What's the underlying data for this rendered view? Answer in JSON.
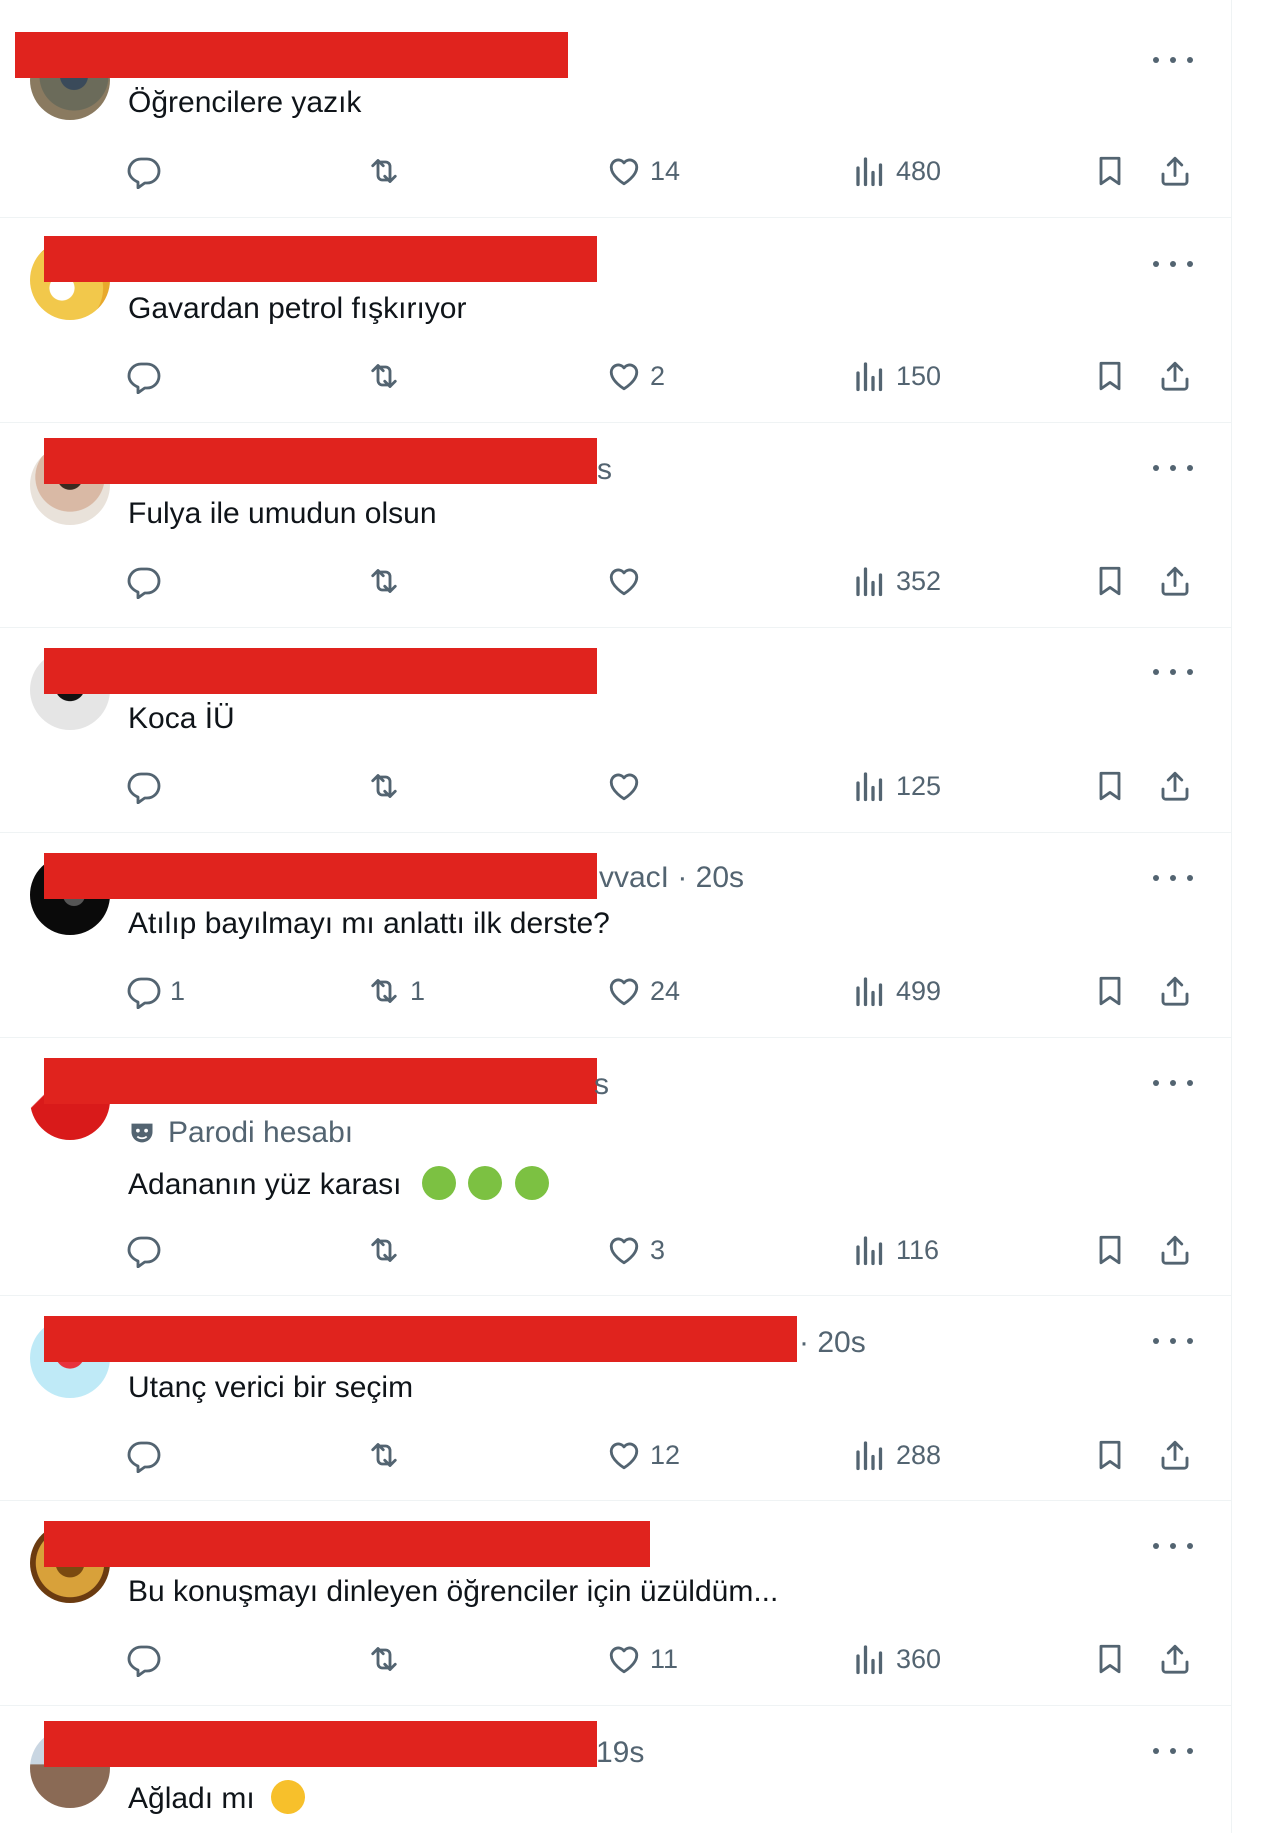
{
  "colors": {
    "redaction": "#e0231e",
    "secondary_text": "#536471",
    "divider": "#eff3f4"
  },
  "icons": {
    "reply": "reply-icon",
    "retweet": "retweet-icon",
    "like": "heart-icon",
    "views": "views-icon",
    "bookmark": "bookmark-icon",
    "share": "share-icon",
    "more": "more-icon"
  },
  "tweets": [
    {
      "header_tail": "",
      "text": "Öğrencilere yazık",
      "replies": "",
      "retweets": "",
      "likes": "14",
      "views": "480"
    },
    {
      "header_tail": "",
      "text": "Gavardan petrol fışkırıyor",
      "replies": "",
      "retweets": "",
      "likes": "2",
      "views": "150"
    },
    {
      "header_tail": "s",
      "text": "Fulya ile umudun olsun",
      "replies": "",
      "retweets": "",
      "likes": "",
      "views": "352"
    },
    {
      "header_tail": "",
      "text": "Koca İÜ",
      "replies": "",
      "retweets": "",
      "likes": "",
      "views": "125"
    },
    {
      "header_tail": "vvacI · 20s",
      "text": "Atılıp bayılmayı mı anlattı ilk derste?",
      "replies": "1",
      "retweets": "1",
      "likes": "24",
      "views": "499"
    },
    {
      "header_tail": "s",
      "badge": "Parodi hesabı",
      "text": "Adananın yüz karası",
      "emoji": [
        "nauseated-face",
        "nauseated-face",
        "nauseated-face"
      ],
      "replies": "",
      "retweets": "",
      "likes": "3",
      "views": "116"
    },
    {
      "header_tail": "· 20s",
      "text": "Utanç verici bir seçim",
      "replies": "",
      "retweets": "",
      "likes": "12",
      "views": "288"
    },
    {
      "header_tail": "",
      "text": "Bu konuşmayı dinleyen öğrenciler için üzüldüm...",
      "replies": "",
      "retweets": "",
      "likes": "11",
      "views": "360"
    },
    {
      "header_tail": "19s",
      "text": "Ağladı mı",
      "emoji": [
        "rolling-on-floor-laughing"
      ]
    }
  ]
}
